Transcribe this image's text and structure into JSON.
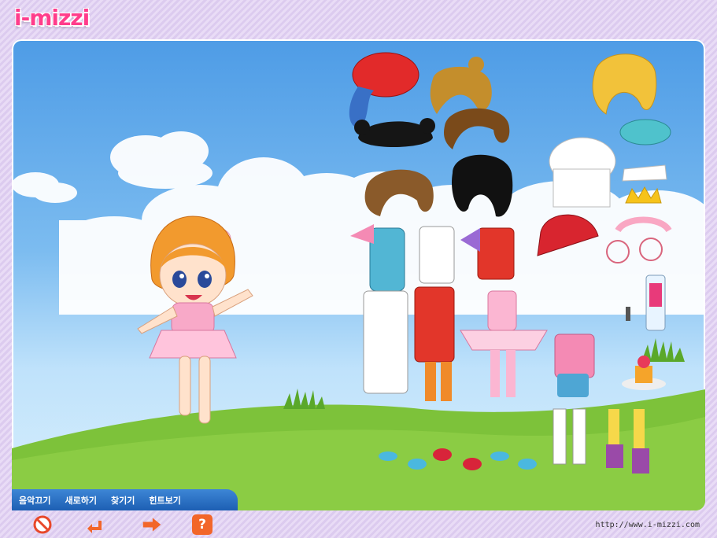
{
  "brand": {
    "logo_text": "i-mizzi"
  },
  "menu": {
    "items": [
      {
        "label": "음악끄기"
      },
      {
        "label": "새로하기"
      },
      {
        "label": "찾기기"
      },
      {
        "label": "힌트보기"
      }
    ]
  },
  "toolbar": {
    "buttons": [
      {
        "name": "stop-button",
        "icon": "no-entry-icon"
      },
      {
        "name": "undo-button",
        "icon": "undo-arrow-icon"
      },
      {
        "name": "next-button",
        "icon": "right-arrow-icon"
      },
      {
        "name": "help-button",
        "icon": "question-icon",
        "label": "?"
      }
    ]
  },
  "footer": {
    "url": "http://www.i-mizzi.com"
  },
  "colors": {
    "accent_pink": "#ff3d8b",
    "menu_blue": "#2a70c4",
    "sky_top": "#4e9ce6",
    "grass": "#7dc23a"
  }
}
